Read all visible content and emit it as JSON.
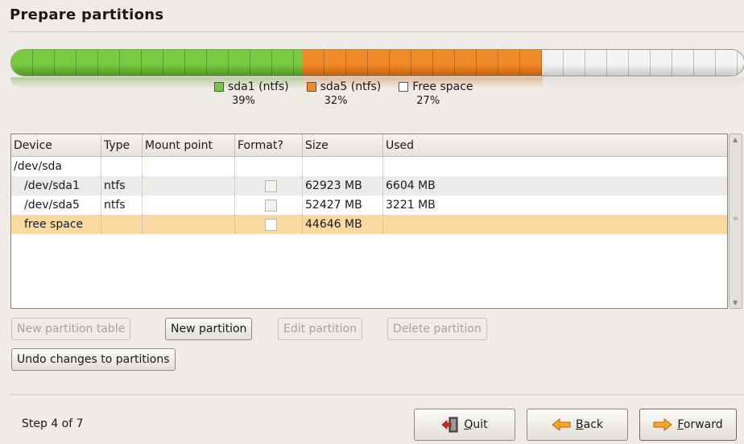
{
  "page": {
    "title": "Prepare partitions"
  },
  "partition_bar": {
    "segments": [
      {
        "name": "sda1",
        "fraction": 0.39,
        "color": "#7ac943",
        "edge": "#4f9a1e"
      },
      {
        "name": "sda5",
        "fraction": 0.32,
        "color": "#f08a28",
        "edge": "#c8640e"
      },
      {
        "name": "free",
        "fraction": 0.27,
        "color": "#f4f4f4",
        "edge": "#c9c9c9"
      }
    ]
  },
  "legend": [
    {
      "label": "sda1 (ntfs)",
      "pct": "39%",
      "color": "#7ac943"
    },
    {
      "label": "sda5 (ntfs)",
      "pct": "32%",
      "color": "#f08a28"
    },
    {
      "label": "Free space",
      "pct": "27%",
      "color": "#ffffff"
    }
  ],
  "table": {
    "headers": [
      "Device",
      "Type",
      "Mount point",
      "Format?",
      "Size",
      "Used"
    ],
    "rows": [
      {
        "device": "/dev/sda",
        "type": "",
        "mount": "",
        "format": false,
        "size": "",
        "used": ""
      },
      {
        "device": "/dev/sda1",
        "type": "ntfs",
        "mount": "",
        "format": false,
        "size": "62923 MB",
        "used": "6604 MB"
      },
      {
        "device": "/dev/sda5",
        "type": "ntfs",
        "mount": "",
        "format": false,
        "size": "52427 MB",
        "used": "3221 MB"
      },
      {
        "device": "free space",
        "type": "",
        "mount": "",
        "format": false,
        "size": "44646 MB",
        "used": ""
      }
    ]
  },
  "buttons": {
    "new_table": "New partition table",
    "new_partition": "New partition",
    "edit_partition": "Edit partition",
    "delete_partition": "Delete partition",
    "undo": "Undo changes to partitions"
  },
  "footer": {
    "step": "Step 4 of 7",
    "quit_u": "Q",
    "quit_rest": "uit",
    "back_u": "B",
    "back_rest": "ack",
    "forward_u": "F",
    "forward_rest": "orward"
  }
}
